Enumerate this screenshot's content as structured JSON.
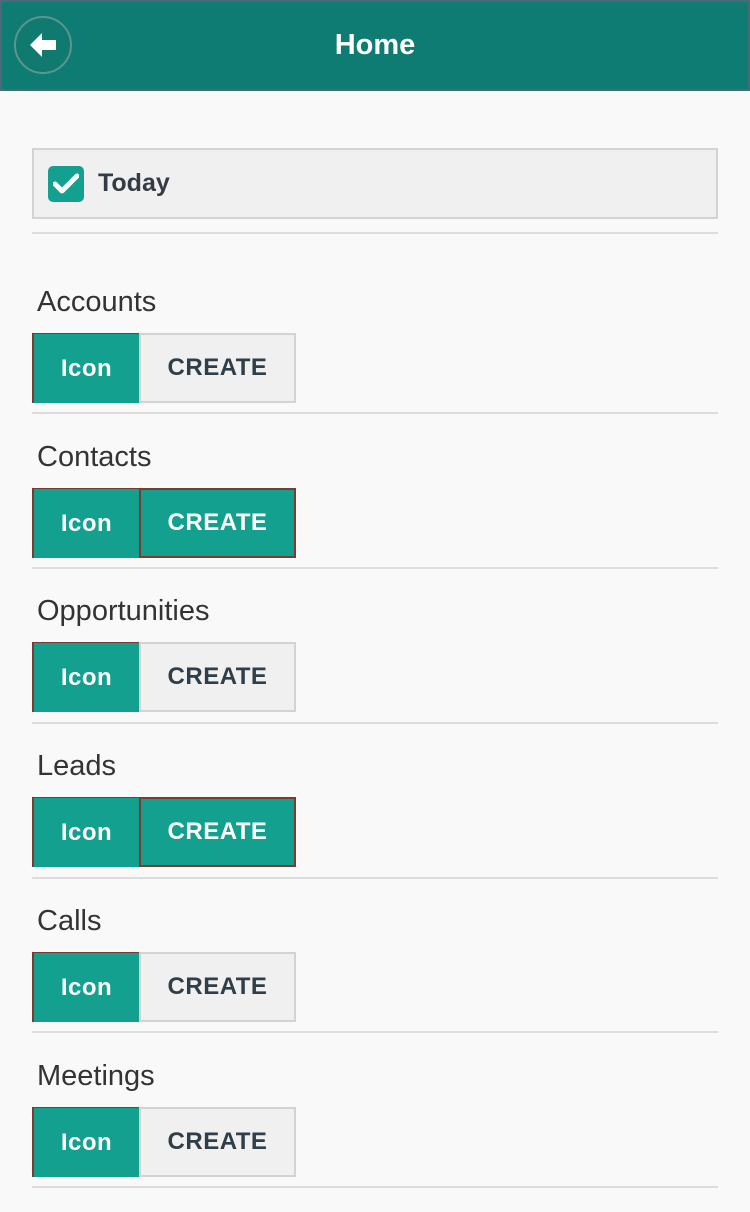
{
  "header": {
    "title": "Home",
    "back_icon": "arrow-left-icon"
  },
  "today": {
    "label": "Today",
    "checked": true
  },
  "sections": [
    {
      "title": "Accounts",
      "icon_label": "Icon",
      "create_label": "CREATE",
      "create_active": false
    },
    {
      "title": "Contacts",
      "icon_label": "Icon",
      "create_label": "CREATE",
      "create_active": true
    },
    {
      "title": "Opportunities",
      "icon_label": "Icon",
      "create_label": "CREATE",
      "create_active": false
    },
    {
      "title": "Leads",
      "icon_label": "Icon",
      "create_label": "CREATE",
      "create_active": true
    },
    {
      "title": "Calls",
      "icon_label": "Icon",
      "create_label": "CREATE",
      "create_active": false
    },
    {
      "title": "Meetings",
      "icon_label": "Icon",
      "create_label": "CREATE",
      "create_active": false
    }
  ],
  "colors": {
    "header": "#0e7c72",
    "accent": "#13a08f",
    "background": "#f9f9f9",
    "inactive_button": "#f0f0f0"
  }
}
